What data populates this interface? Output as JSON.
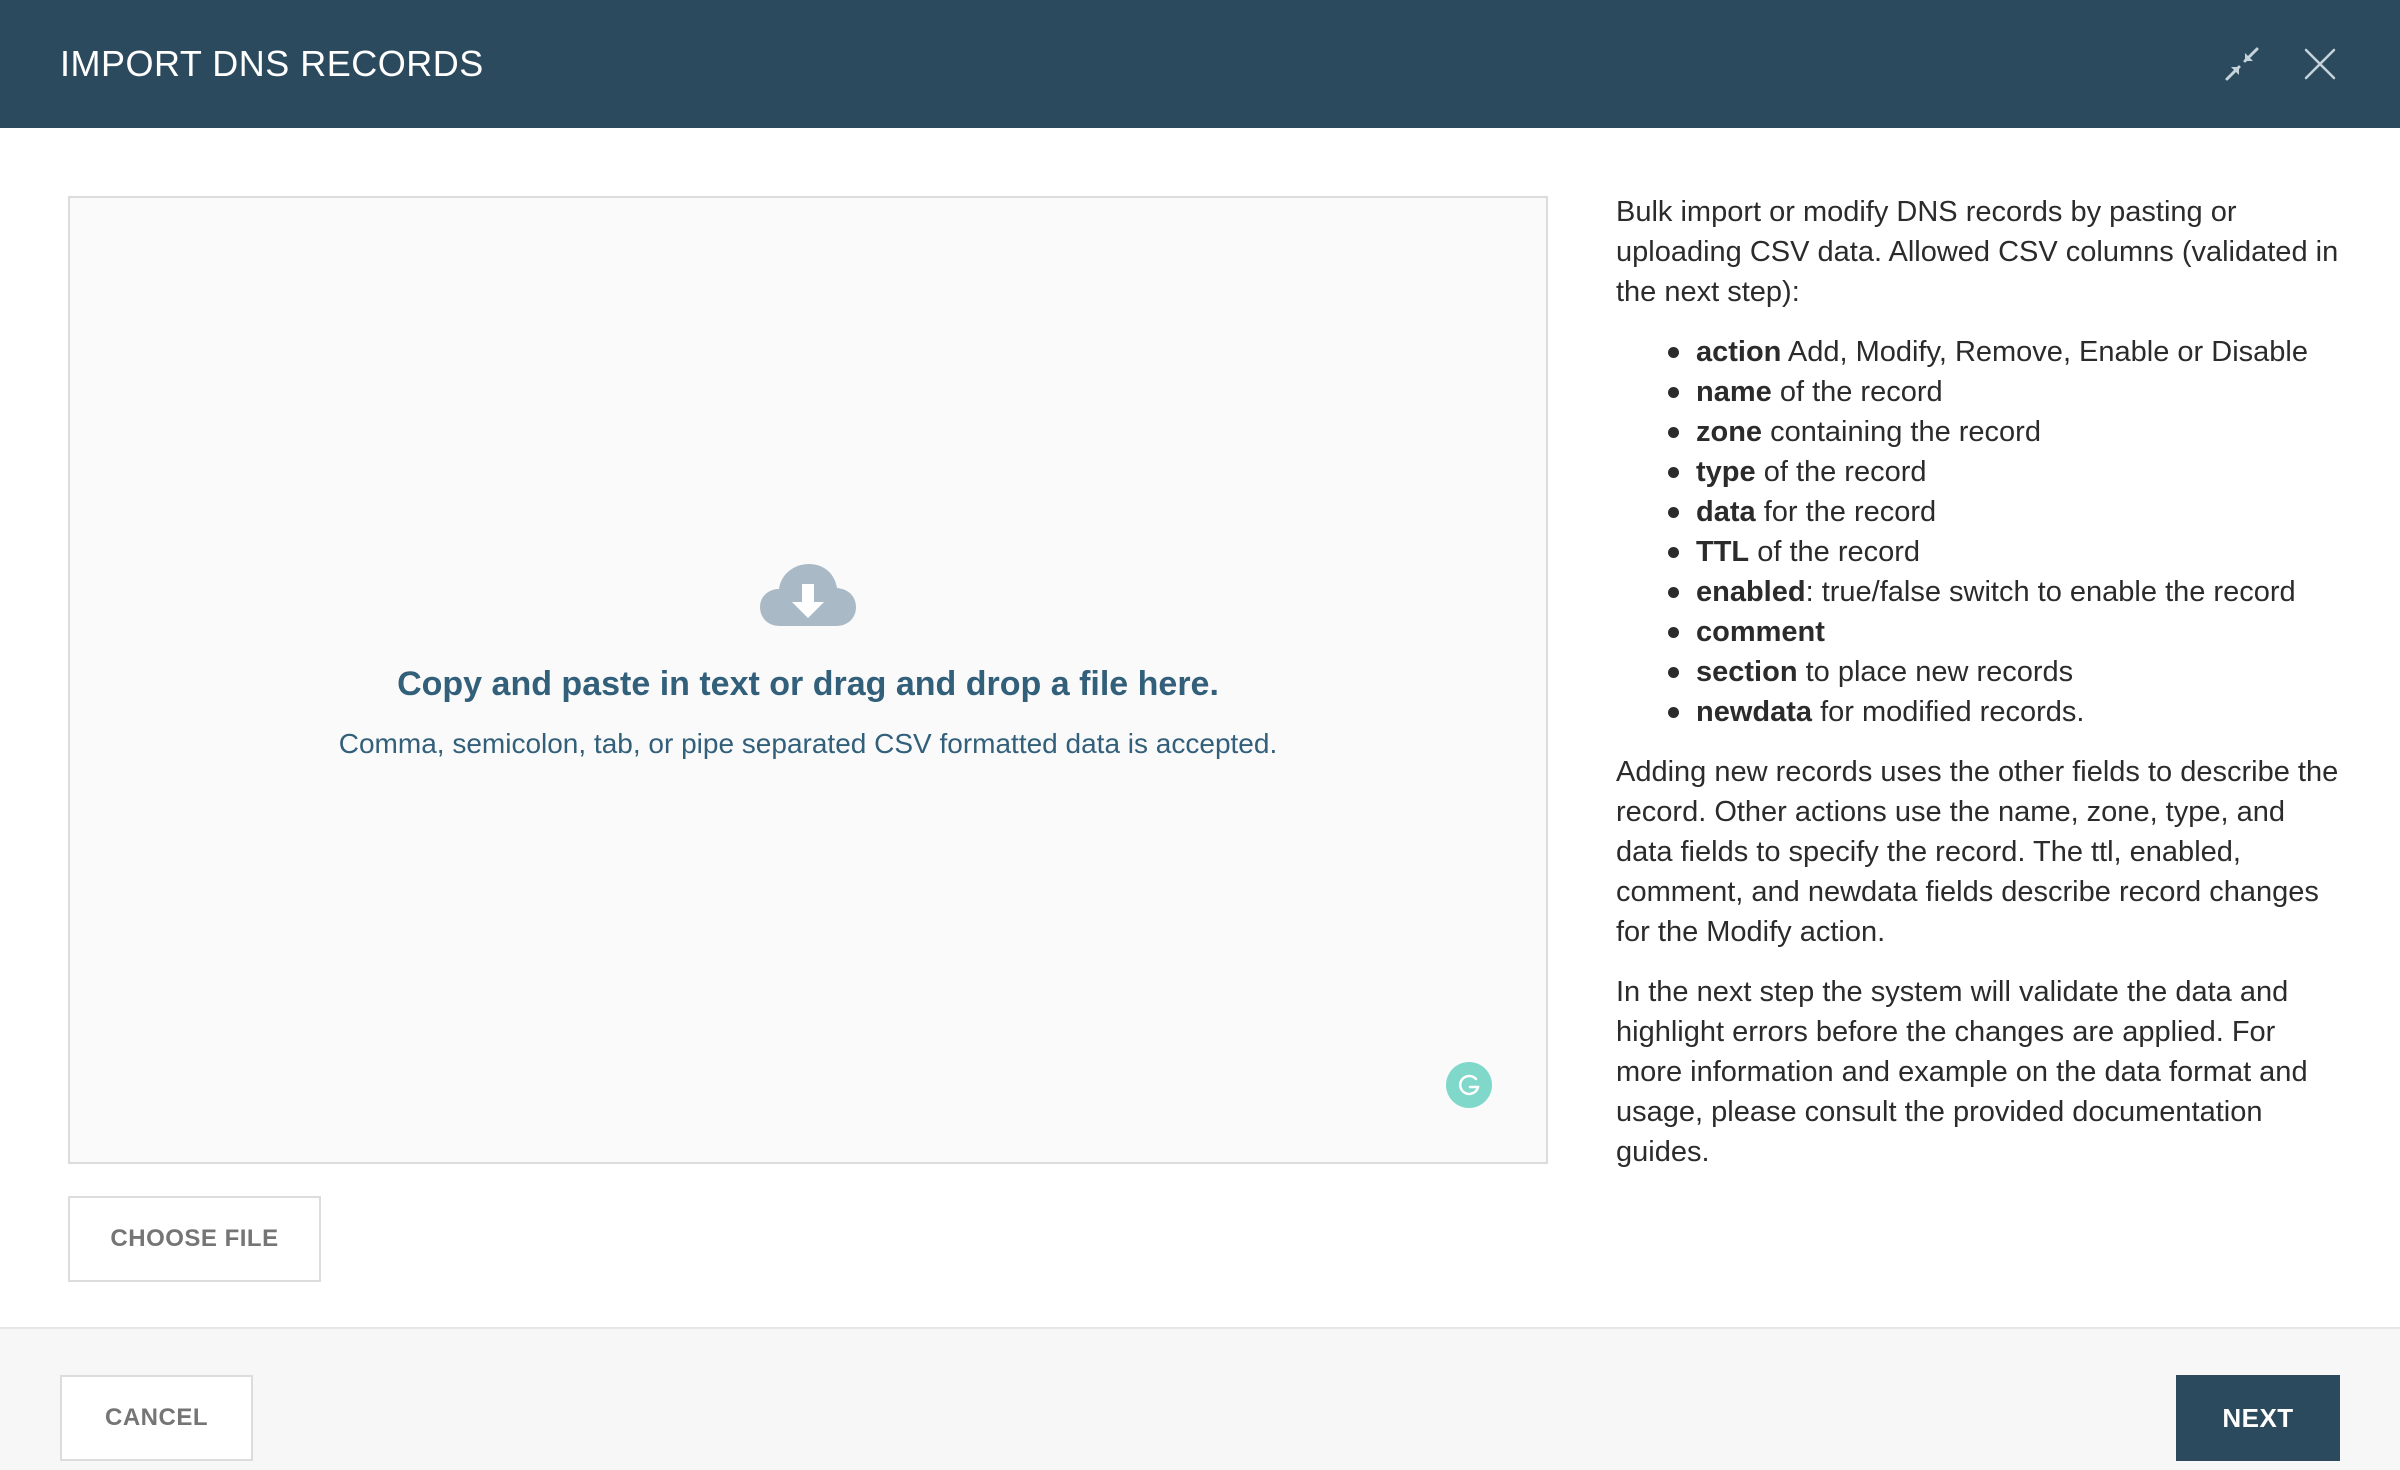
{
  "dialog": {
    "title": "IMPORT DNS RECORDS",
    "icons": {
      "collapse": "collapse-arrows-icon",
      "close": "close-icon"
    }
  },
  "dropzone": {
    "icon": "cloud-download-icon",
    "title": "Copy and paste in text or drag and drop a file here.",
    "subtitle": "Comma, semicolon, tab, or pipe separated CSV formatted data is accepted.",
    "badge_icon": "grammarly-icon"
  },
  "choose_file_label": "CHOOSE FILE",
  "info": {
    "intro": "Bulk import or modify DNS records by pasting or uploading CSV data. Allowed CSV columns (validated in the next step):",
    "columns": [
      {
        "name": "action",
        "desc": " Add, Modify, Remove, Enable or Disable"
      },
      {
        "name": "name",
        "desc": " of the record"
      },
      {
        "name": "zone",
        "desc": " containing the record"
      },
      {
        "name": "type",
        "desc": " of the record"
      },
      {
        "name": "data",
        "desc": " for the record"
      },
      {
        "name": "TTL",
        "desc": " of the record"
      },
      {
        "name": "enabled",
        "desc": ": true/false switch to enable the record"
      },
      {
        "name": "comment",
        "desc": ""
      },
      {
        "name": "section",
        "desc": " to place new records"
      },
      {
        "name": "newdata",
        "desc": " for modified records."
      }
    ],
    "paragraph2": "Adding new records uses the other fields to describe the record. Other actions use the name, zone, type, and data fields to specify the record. The ttl, enabled, comment, and newdata fields describe record changes for the Modify action.",
    "paragraph3": "In the next step the system will validate the data and highlight errors before the changes are applied. For more information and example on the data format and usage, please consult the provided documentation guides."
  },
  "footer": {
    "cancel_label": "CANCEL",
    "next_label": "NEXT"
  },
  "colors": {
    "header_bg": "#2c4a5e",
    "accent_text": "#325f7a",
    "next_bg": "#2c4a5e"
  }
}
